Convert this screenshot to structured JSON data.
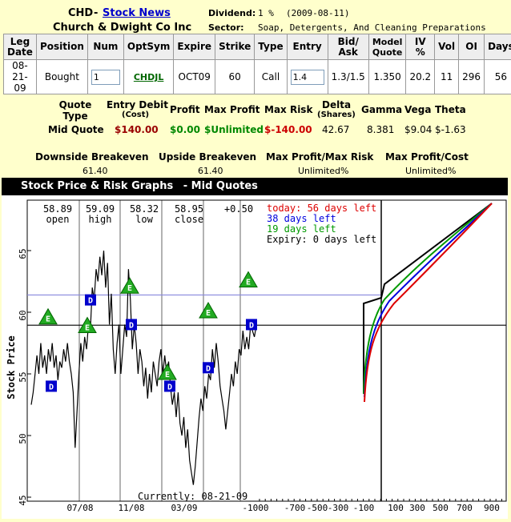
{
  "header": {
    "symbol": "CHD",
    "dash": "-",
    "stock_news_link": "Stock News",
    "company_name": "Church & Dwight Co Inc",
    "dividend_label": "Dividend:",
    "dividend_value": "1 %",
    "dividend_date": "(2009-08-11)",
    "sector_label": "Sector:",
    "sector_value": "Soap, Detergents, And Cleaning Preparations"
  },
  "legs_table": {
    "columns": [
      "Leg Date",
      "Position",
      "Num",
      "OptSym",
      "Expire",
      "Strike",
      "Type",
      "Entry",
      "Bid/\nAsk",
      "Model\nQuote",
      "IV %",
      "Vol",
      "OI",
      "Days"
    ],
    "row": {
      "leg_date": "08-21-09",
      "position": "Bought",
      "num": "1",
      "optsym": "CHDJL",
      "expire": "OCT09",
      "strike": "60",
      "type": "Call",
      "entry": "1.4",
      "bid_ask": "1.3/1.5",
      "model_quote": "1.350",
      "iv": "20.2",
      "vol": "11",
      "oi": "296",
      "days": "56"
    }
  },
  "summary": {
    "quote_type_label": "Quote\nType",
    "entry_debit_label": "Entry Debit",
    "entry_debit_sub": "(Cost)",
    "profit_label": "Profit",
    "max_profit_label": "Max Profit",
    "max_risk_label": "Max Risk",
    "delta_label": "Delta",
    "delta_sub": "(Shares)",
    "gamma_label": "Gamma",
    "vega_label": "Vega",
    "theta_label": "Theta",
    "quote_type": "Mid Quote",
    "entry_debit": "$140.00",
    "profit": "$0.00",
    "max_profit": "$Unlimited",
    "max_risk": "$-140.00",
    "delta": "42.67",
    "gamma": "8.381",
    "vega": "$9.04",
    "theta": "$-1.63",
    "downside_breakeven_label": "Downside Breakeven",
    "upside_breakeven_label": "Upside Breakeven",
    "max_profit_risk_label": "Max Profit/Max Risk",
    "max_profit_cost_label": "Max Profit/Cost",
    "downside_breakeven": "61.40",
    "upside_breakeven": "61.40",
    "max_profit_risk": "Unlimited%",
    "max_profit_cost": "Unlimited%"
  },
  "panel": {
    "title": "Stock Price & Risk Graphs",
    "subtitle": "- Mid Quotes"
  },
  "chart_data": {
    "type": "line",
    "ylabel": "Stock Price",
    "y_ticks": [
      "65",
      "60",
      "55",
      "50",
      "45"
    ],
    "x_ticks_time": [
      "07/08",
      "11/08",
      "03/09"
    ],
    "x_ticks_pnl": [
      "-1000",
      "-700",
      "-500",
      "-300",
      "-100",
      "100",
      "300",
      "500",
      "700",
      "900"
    ],
    "quote": {
      "open": "58.89",
      "open_label": "open",
      "high": "59.09",
      "high_label": "high",
      "low": "58.32",
      "low_label": "low",
      "close": "58.95",
      "close_label": "close",
      "change": "+0.50"
    },
    "currently": "Currently: 08-21-09",
    "legend": [
      {
        "label": "today: 56 days left",
        "color": "#DD0000"
      },
      {
        "label": "38 days left",
        "color": "#0000DD"
      },
      {
        "label": "19 days left",
        "color": "#009900"
      },
      {
        "label": "Expiry: 0 days left",
        "color": "#000000"
      }
    ],
    "current_price": 58.95,
    "breakeven": 61.4,
    "price_series": [
      52.5,
      53.5,
      55,
      56.5,
      55,
      57.5,
      55.5,
      56.5,
      55,
      57,
      56,
      57.5,
      55.5,
      56.5,
      54.5,
      56,
      55.5,
      57,
      56,
      57.5,
      56,
      55,
      53.5,
      49,
      52,
      55,
      57.5,
      56,
      58,
      57,
      59,
      58.5,
      62,
      61,
      63.5,
      62.5,
      64.5,
      63,
      65,
      62,
      64,
      59,
      61.5,
      57,
      55,
      57.5,
      59,
      55,
      57,
      59,
      58,
      63.5,
      61,
      57,
      59,
      57.5,
      55,
      57,
      56,
      54,
      55.5,
      53,
      55,
      53.5,
      56,
      55,
      54,
      56,
      57,
      55,
      56.5,
      55,
      56,
      54,
      52.5,
      53.5,
      51.5,
      53.5,
      51,
      50,
      51.5,
      49,
      50.5,
      48,
      47,
      46,
      47.5,
      49.5,
      51.5,
      53,
      52,
      54,
      53,
      55,
      54.5,
      57,
      55.5,
      57.5,
      56,
      54,
      53,
      52,
      50.5,
      52,
      53.5,
      55,
      54,
      56,
      55,
      57,
      56.5,
      58.5,
      57,
      58,
      57,
      59,
      58.5,
      58,
      58.9
    ],
    "markers": [
      {
        "type": "E",
        "price": 59.5
      },
      {
        "type": "D",
        "price": 54
      },
      {
        "type": "E",
        "price": 58.8
      },
      {
        "type": "D",
        "price": 61
      },
      {
        "type": "E",
        "price": 62
      },
      {
        "type": "D",
        "price": 59
      },
      {
        "type": "E",
        "price": 55
      },
      {
        "type": "D",
        "price": 54
      },
      {
        "type": "D",
        "price": 55.5
      },
      {
        "type": "E",
        "price": 60
      },
      {
        "type": "E",
        "price": 62.5
      },
      {
        "type": "D",
        "price": 59
      }
    ]
  }
}
